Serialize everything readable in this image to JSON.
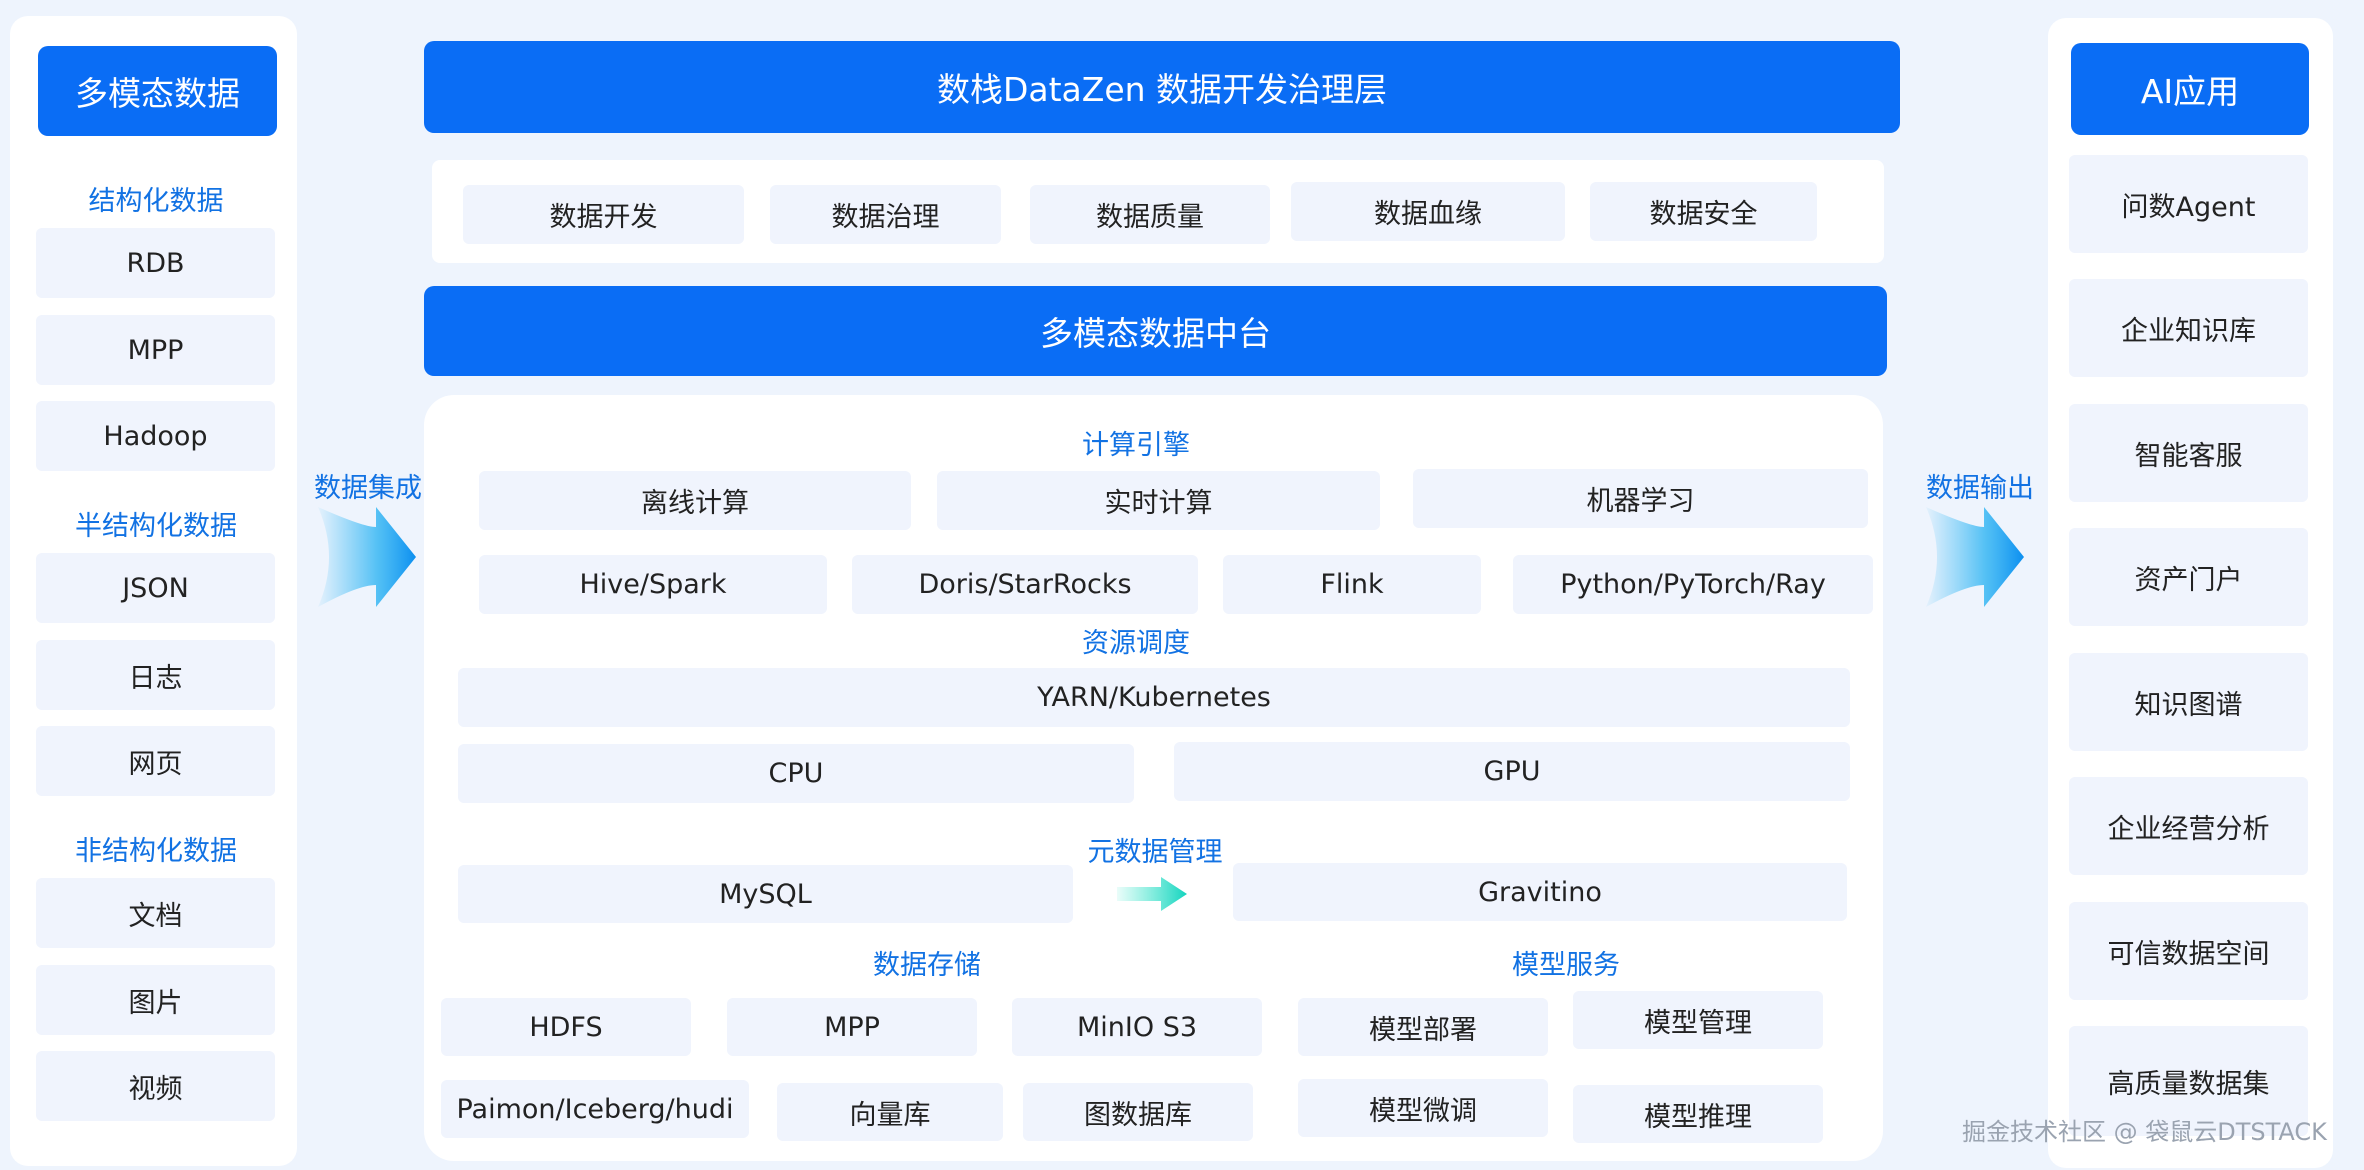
{
  "left": {
    "title": "多模态数据",
    "structured": {
      "label": "结构化数据",
      "items": [
        "RDB",
        "MPP",
        "Hadoop"
      ]
    },
    "semi": {
      "label": "半结构化数据",
      "items": [
        "JSON",
        "日志",
        "网页"
      ]
    },
    "unstructured": {
      "label": "非结构化数据",
      "items": [
        "文档",
        "图片",
        "视频"
      ]
    }
  },
  "flow": {
    "in_label": "数据集成",
    "out_label": "数据输出"
  },
  "center": {
    "top_title": "数栈DataZen 数据开发治理层",
    "governance": [
      "数据开发",
      "数据治理",
      "数据质量",
      "数据血缘",
      "数据安全"
    ],
    "mid_title": "多模态数据中台",
    "compute": {
      "label": "计算引擎",
      "row1": [
        "离线计算",
        "实时计算",
        "机器学习"
      ],
      "row2": [
        "Hive/Spark",
        "Doris/StarRocks",
        "Flink",
        "Python/PyTorch/Ray"
      ]
    },
    "resource": {
      "label": "资源调度",
      "yarn": "YARN/Kubernetes",
      "cpu": "CPU",
      "gpu": "GPU"
    },
    "metadata": {
      "label": "元数据管理",
      "mysql": "MySQL",
      "gravitino": "Gravitino"
    },
    "storage": {
      "label": "数据存储",
      "items": [
        "HDFS",
        "MPP",
        "MinIO S3",
        "Paimon/Iceberg/hudi",
        "向量库",
        "图数据库"
      ]
    },
    "model": {
      "label": "模型服务",
      "items": [
        "模型部署",
        "模型管理",
        "模型微调",
        "模型推理"
      ]
    }
  },
  "right": {
    "title": "AI应用",
    "items": [
      "问数Agent",
      "企业知识库",
      "智能客服",
      "资产门户",
      "知识图谱",
      "企业经营分析",
      "可信数据空间",
      "高质量数据集"
    ]
  },
  "watermark": "掘金技术社区 @ 袋鼠云DTSTACK",
  "colors": {
    "primary": "#0a6df5",
    "accent_text": "#1272e3",
    "cell_bg": "#f0f4fd",
    "page_bg": "#eef4fd"
  }
}
